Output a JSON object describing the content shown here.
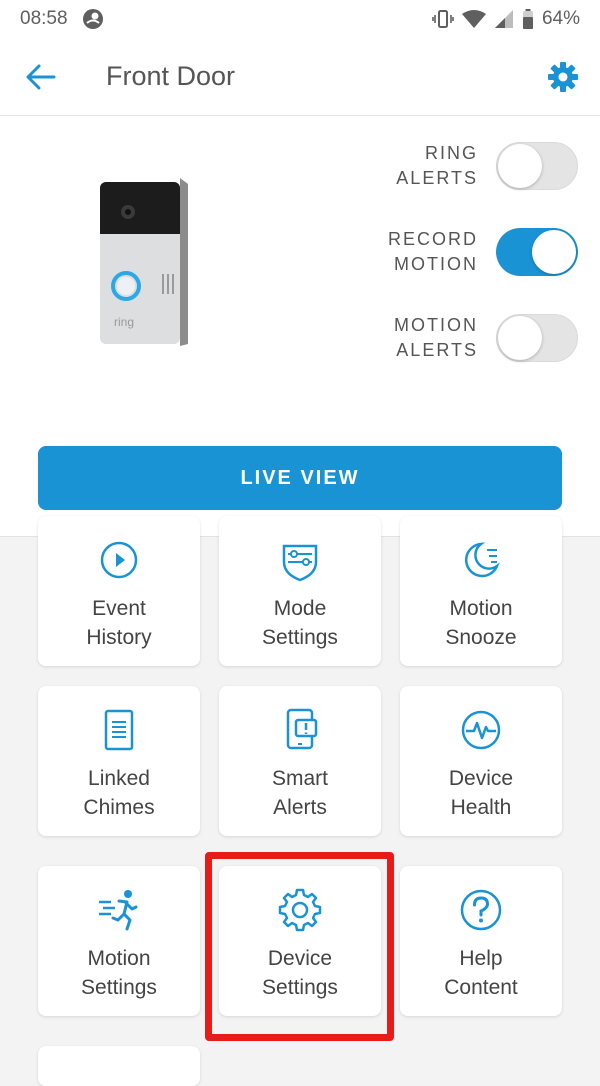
{
  "status_bar": {
    "time": "08:58",
    "battery": "64%"
  },
  "header": {
    "title": "Front Door"
  },
  "toggles": [
    {
      "label": "RING\nALERTS",
      "state": "off"
    },
    {
      "label": "RECORD\nMOTION",
      "state": "on"
    },
    {
      "label": "MOTION\nALERTS",
      "state": "off"
    }
  ],
  "live_view": {
    "label": "LIVE VIEW"
  },
  "tiles": {
    "event_history": "Event\nHistory",
    "mode_settings": "Mode\nSettings",
    "motion_snooze": "Motion\nSnooze",
    "linked_chimes": "Linked\nChimes",
    "smart_alerts": "Smart\nAlerts",
    "device_health": "Device\nHealth",
    "motion_settings": "Motion\nSettings",
    "device_settings": "Device\nSettings",
    "help_content": "Help\nContent"
  },
  "colors": {
    "accent": "#1a93d5",
    "highlight": "#e81b1b"
  }
}
